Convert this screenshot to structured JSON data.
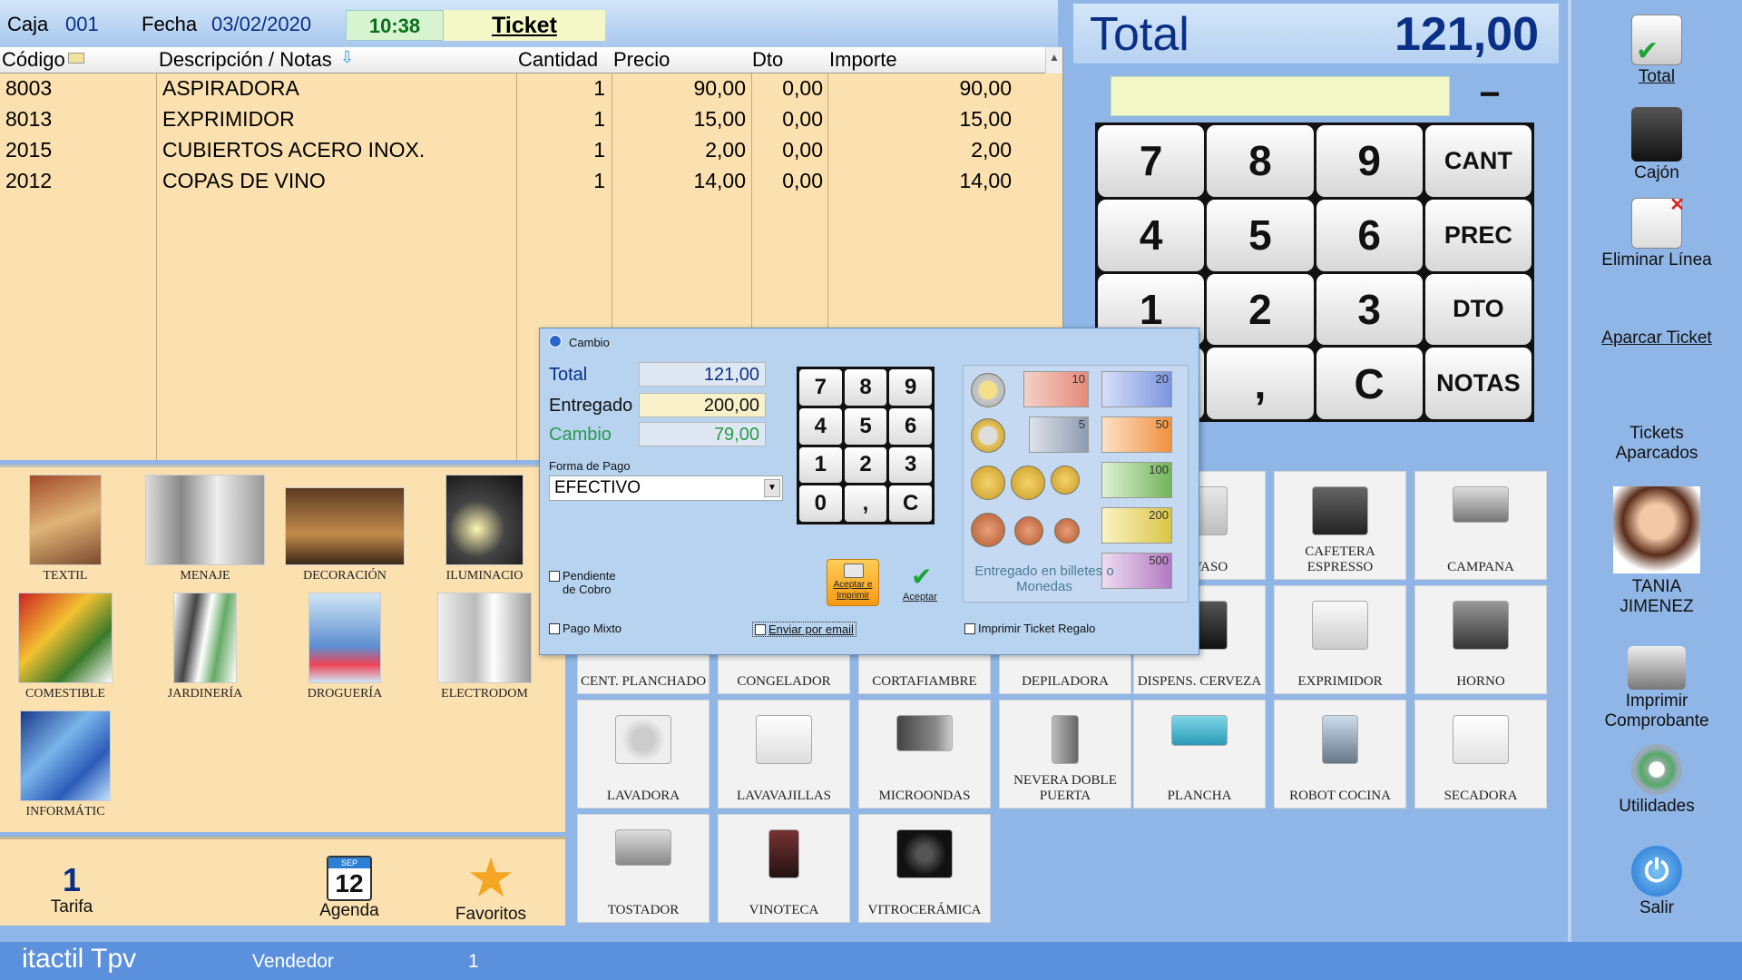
{
  "header": {
    "caja_label": "Caja",
    "caja_value": "001",
    "fecha_label": "Fecha",
    "fecha_value": "03/02/2020",
    "time": "10:38",
    "ticket_tab": "Ticket"
  },
  "table": {
    "columns": [
      "Código",
      "Descripción / Notas",
      "Cantidad",
      "Precio",
      "Dto",
      "Importe"
    ],
    "rows": [
      {
        "code": "8003",
        "desc": "ASPIRADORA",
        "qty": "1",
        "price": "90,00",
        "dto": "0,00",
        "amount": "90,00"
      },
      {
        "code": "8013",
        "desc": "EXPRIMIDOR",
        "qty": "1",
        "price": "15,00",
        "dto": "0,00",
        "amount": "15,00"
      },
      {
        "code": "2015",
        "desc": "CUBIERTOS ACERO INOX.",
        "qty": "1",
        "price": "2,00",
        "dto": "0,00",
        "amount": "2,00"
      },
      {
        "code": "2012",
        "desc": "COPAS DE VINO",
        "qty": "1",
        "price": "14,00",
        "dto": "0,00",
        "amount": "14,00"
      }
    ]
  },
  "families": [
    "TEXTIL",
    "MENAJE",
    "DECORACIÓN",
    "ILUMINACIO",
    "COMESTIBLE",
    "JARDINERÍA",
    "DROGUERÍA",
    "ELECTRODOM",
    "INFORMÁTIC"
  ],
  "bottom_tools": {
    "tarifa_value": "1",
    "tarifa_label": "Tarifa",
    "agenda_label": "Agenda",
    "agenda_day": "12",
    "agenda_month": "SEP",
    "favoritos_label": "Favoritos"
  },
  "total": {
    "label": "Total",
    "value": "121,00",
    "minus": "−"
  },
  "keypad": [
    "7",
    "8",
    "9",
    "CANT",
    "4",
    "5",
    "6",
    "PREC",
    "1",
    "2",
    "3",
    "DTO",
    "0",
    ",",
    "C",
    "NOTAS"
  ],
  "products": [
    {
      "label": "CAFETERA ESPRESSO"
    },
    {
      "label": "CAMPANA"
    },
    {
      "label": "CENT. PLANCHADO"
    },
    {
      "label": "CONGELADOR"
    },
    {
      "label": "CORTAFIAMBRE"
    },
    {
      "label": "DEPILADORA"
    },
    {
      "label": "DISPENS. CERVEZA"
    },
    {
      "label": "EXPRIMIDOR"
    },
    {
      "label": "HORNO"
    },
    {
      "label": "LAVADORA"
    },
    {
      "label": "LAVAVAJILLAS"
    },
    {
      "label": "MICROONDAS"
    },
    {
      "label": "NEVERA DOBLE PUERTA"
    },
    {
      "label": "PLANCHA"
    },
    {
      "label": "ROBOT COCINA"
    },
    {
      "label": "SECADORA"
    },
    {
      "label": "TOSTADOR"
    },
    {
      "label": "VINOTECA"
    },
    {
      "label": "VITROCERÁMICA"
    },
    {
      "label": "RA VASO"
    }
  ],
  "sidebar": {
    "total": "Total",
    "cajon": "Cajón",
    "eliminar": "Eliminar Línea",
    "aparcar": "Aparcar Ticket",
    "tickets_aparcados": "Tickets Aparcados",
    "user_name": "TANIA JIMENEZ",
    "imprimir": "Imprimir Comprobante",
    "utilidades": "Utilidades",
    "salir": "Salir"
  },
  "status": {
    "app": "itactil Tpv",
    "vendedor_label": "Vendedor",
    "vendedor_value": "1"
  },
  "cambio": {
    "title": "Cambio",
    "total_label": "Total",
    "total_value": "121,00",
    "entregado_label": "Entregado",
    "entregado_value": "200,00",
    "cambio_label": "Cambio",
    "cambio_value": "79,00",
    "forma_pago_label": "Forma de Pago",
    "forma_pago_value": "EFECTIVO",
    "keys": [
      "7",
      "8",
      "9",
      "4",
      "5",
      "6",
      "1",
      "2",
      "3",
      "0",
      ",",
      "C"
    ],
    "coins": [
      "1",
      "2",
      "50",
      "20",
      "10",
      "5",
      "2",
      "1"
    ],
    "notes": [
      "10",
      "20",
      "5",
      "50",
      "100",
      "200",
      "500"
    ],
    "money_caption": "Entregado en billetes o Monedas",
    "pendiente": "Pendiente de Cobro",
    "aceptar_imprimir": "Aceptar e Imprimir",
    "aceptar": "Aceptar",
    "pago_mixto": "Pago Mixto",
    "enviar_email": "Enviar por email",
    "ticket_regalo": "Imprimir Ticket Regalo"
  },
  "colors": {
    "accent": "#0a2f86",
    "panel": "#fbe0b0",
    "background": "#8fb6e6",
    "status": "#5a90dc"
  }
}
